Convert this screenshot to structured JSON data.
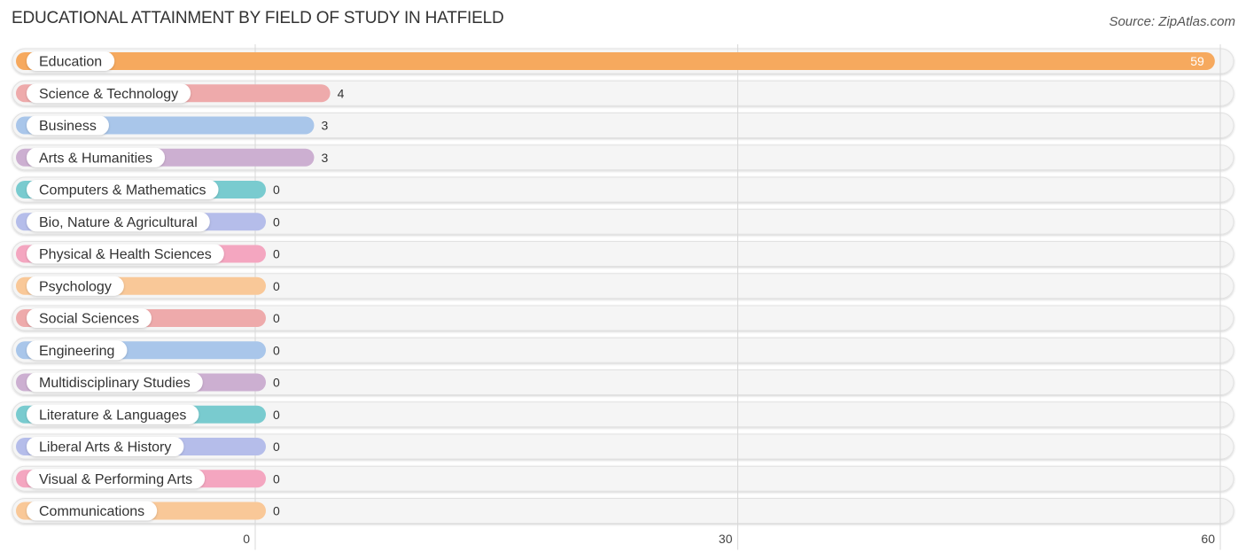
{
  "header": {
    "title": "EDUCATIONAL ATTAINMENT BY FIELD OF STUDY IN HATFIELD",
    "source": "Source: ZipAtlas.com"
  },
  "chart_data": {
    "type": "bar",
    "orientation": "horizontal",
    "title": "EDUCATIONAL ATTAINMENT BY FIELD OF STUDY IN HATFIELD",
    "xlabel": "",
    "ylabel": "",
    "xlim": [
      0,
      60
    ],
    "xticks": [
      "0",
      "30",
      "60"
    ],
    "grid": true,
    "categories": [
      "Education",
      "Science & Technology",
      "Business",
      "Arts & Humanities",
      "Computers & Mathematics",
      "Bio, Nature & Agricultural",
      "Physical & Health Sciences",
      "Psychology",
      "Social Sciences",
      "Engineering",
      "Multidisciplinary Studies",
      "Literature & Languages",
      "Liberal Arts & History",
      "Visual & Performing Arts",
      "Communications"
    ],
    "values": [
      59,
      4,
      3,
      3,
      0,
      0,
      0,
      0,
      0,
      0,
      0,
      0,
      0,
      0,
      0
    ],
    "value_labels": [
      "59",
      "4",
      "3",
      "3",
      "0",
      "0",
      "0",
      "0",
      "0",
      "0",
      "0",
      "0",
      "0",
      "0",
      "0"
    ],
    "colors": [
      "#f6a95e",
      "#eeaaab",
      "#a9c6ea",
      "#ccafd1",
      "#79cbcf",
      "#b5bdea",
      "#f4a6c0",
      "#f9c898",
      "#eeaaab",
      "#a9c6ea",
      "#ccafd1",
      "#79cbcf",
      "#b5bdea",
      "#f4a6c0",
      "#f9c898"
    ]
  }
}
